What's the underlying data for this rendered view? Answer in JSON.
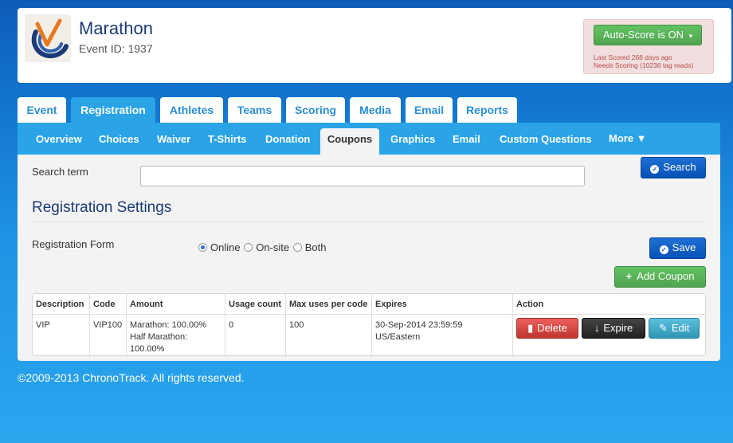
{
  "header": {
    "title": "Marathon",
    "event_id": "Event ID: 1937",
    "logo_icon": "chronotrack-logo",
    "autoscore": {
      "button_label": "Auto-Score is ON",
      "caret": "▾",
      "last_scored": "Last Scored 268 days ago",
      "needs_scoring": "Needs Scoring (10236 tag reads)"
    }
  },
  "main_tabs": [
    {
      "label": "Event"
    },
    {
      "label": "Registration"
    },
    {
      "label": "Athletes"
    },
    {
      "label": "Teams"
    },
    {
      "label": "Scoring"
    },
    {
      "label": "Media"
    },
    {
      "label": "Email"
    },
    {
      "label": "Reports"
    }
  ],
  "sub_tabs": [
    {
      "label": "Overview"
    },
    {
      "label": "Choices"
    },
    {
      "label": "Waiver"
    },
    {
      "label": "T-Shirts"
    },
    {
      "label": "Donation"
    },
    {
      "label": "Coupons"
    },
    {
      "label": "Graphics"
    },
    {
      "label": "Email"
    },
    {
      "label": "Custom Questions"
    },
    {
      "label": "More ▼"
    }
  ],
  "search": {
    "label": "Search term",
    "value": "",
    "button_label": "Search"
  },
  "settings": {
    "title": "Registration Settings",
    "form_label": "Registration Form",
    "options": [
      "Online",
      "On-site",
      "Both"
    ],
    "selected": "Online",
    "save_label": "Save",
    "add_coupon_label": "Add Coupon"
  },
  "coupons_table": {
    "headers": [
      "Description",
      "Code",
      "Amount",
      "Usage count",
      "Max uses per code",
      "Expires",
      "Action"
    ],
    "rows": [
      {
        "description": "VIP",
        "code": "VIP100",
        "amount_line1": "Marathon: 100.00%",
        "amount_line2": "Half Marathon: 100.00%",
        "usage_count": "0",
        "max_uses": "100",
        "expires": "30-Sep-2014 23:59:59 US/Eastern",
        "actions": {
          "delete": "Delete",
          "expire": "Expire",
          "edit": "Edit"
        }
      }
    ]
  },
  "footer": {
    "copyright": "©2009-2013 ChronoTrack. All rights reserved."
  },
  "colors": {
    "accent_blue": "#2aa3e7",
    "primary_button": "#0552b5",
    "success": "#51a351",
    "danger": "#bd362f",
    "title_navy": "#1a3a78"
  }
}
